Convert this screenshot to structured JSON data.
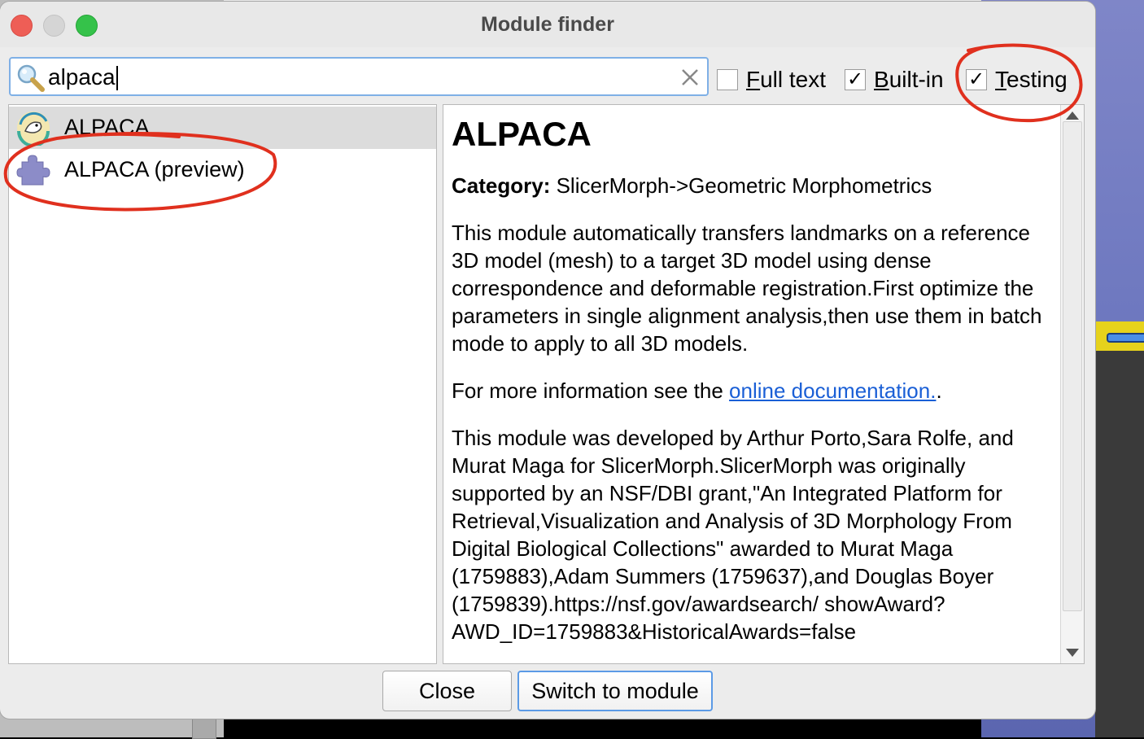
{
  "window": {
    "title": "Module finder"
  },
  "search": {
    "value": "alpaca",
    "placeholder": ""
  },
  "filters": [
    {
      "label": "Full text",
      "checked": false,
      "mnemonic": "F"
    },
    {
      "label": "Built-in",
      "checked": true,
      "mnemonic": "B"
    },
    {
      "label": "Testing",
      "checked": true,
      "mnemonic": "T"
    }
  ],
  "modules": [
    {
      "label": "ALPACA",
      "icon": "alpaca-logo-icon",
      "selected": true
    },
    {
      "label": "ALPACA (preview)",
      "icon": "puzzle-piece-icon",
      "selected": false
    }
  ],
  "details": {
    "title": "ALPACA",
    "category_label": "Category:",
    "category_value": "SlicerMorph->Geometric Morphometrics",
    "description": "This module automatically transfers landmarks on a reference 3D model (mesh) to a target 3D model using dense correspondence and deformable registration.First optimize the parameters in single alignment analysis,then use them in batch mode to apply to all 3D models.",
    "more_info_prefix": "For more information see the ",
    "more_info_link": "online documentation.",
    "more_info_suffix": ".",
    "acknowledgement": "This module was developed by Arthur Porto,Sara Rolfe, and Murat Maga for SlicerMorph.SlicerMorph was originally supported by an NSF/DBI grant,\"An Integrated Platform for Retrieval,Visualization and Analysis of 3D Morphology From Digital Biological Collections\" awarded to Murat Maga (1759883),Adam Summers (1759637),and Douglas Boyer (1759839).https://nsf.gov/awardsearch/ showAward?AWD_ID=1759883&HistoricalAwards=false"
  },
  "buttons": {
    "close": "Close",
    "switch": "Switch to module"
  },
  "colors": {
    "annotation": "#e0301e",
    "focus": "#5b9ae6",
    "link": "#1a5fd6"
  }
}
